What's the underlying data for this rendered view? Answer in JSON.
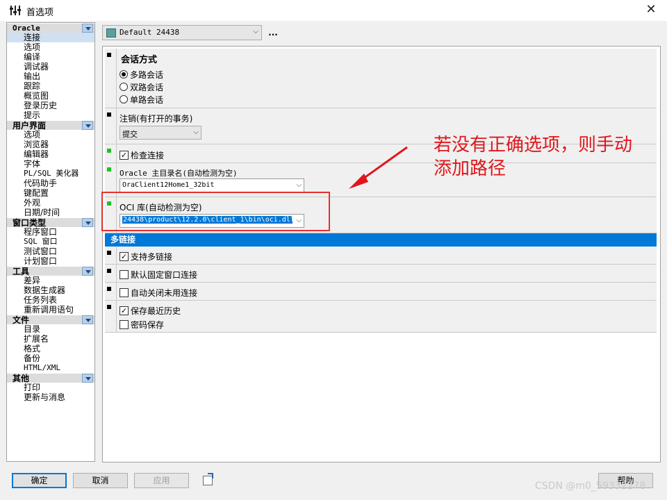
{
  "window": {
    "title": "首选项",
    "close_symbol": "✕"
  },
  "nav": {
    "categories": [
      {
        "label": "Oracle",
        "items": [
          "连接",
          "选项",
          "编译",
          "调试器",
          "输出",
          "跟踪",
          "概览图",
          "登录历史",
          "提示"
        ]
      },
      {
        "label": "用户界面",
        "items": [
          "选项",
          "浏览器",
          "编辑器",
          "字体",
          "PL/SQL 美化器",
          "代码助手",
          "键配置",
          "外观",
          "日期/时间"
        ]
      },
      {
        "label": "窗口类型",
        "items": [
          "程序窗口",
          "SQL 窗口",
          "测试窗口",
          "计划窗口"
        ]
      },
      {
        "label": "工具",
        "items": [
          "差异",
          "数据生成器",
          "任务列表",
          "重新调用语句"
        ]
      },
      {
        "label": "文件",
        "items": [
          "目录",
          "扩展名",
          "格式",
          "备份",
          "HTML/XML"
        ]
      },
      {
        "label": "其他",
        "items": [
          "打印",
          "更新与消息"
        ]
      }
    ],
    "selected": "连接"
  },
  "profile": {
    "value": "Default 24438",
    "more": "..."
  },
  "session": {
    "title": "会话方式",
    "options": [
      "多路会话",
      "双路会话",
      "单路会话"
    ],
    "selected_index": 0
  },
  "logoff": {
    "label": "注销(有打开的事务)",
    "value": "提交"
  },
  "check_connection": {
    "label": "检查连接",
    "checked": true
  },
  "oracle_home": {
    "label": "Oracle 主目录名(自动检测为空)",
    "value": "OraClient12Home1_32bit"
  },
  "oci_library": {
    "label": "OCI 库(自动检测为空)",
    "value": "24438\\product\\12.2.0\\client_1\\bin\\oci.dll"
  },
  "multi": {
    "header": "多链接",
    "support_multi": {
      "label": "支持多链接",
      "checked": true
    },
    "default_fixed": {
      "label": "默认固定窗口连接",
      "checked": false
    },
    "auto_close": {
      "label": "自动关闭未用连接",
      "checked": false
    },
    "save_history": {
      "label": "保存最近历史",
      "checked": true
    },
    "save_password": {
      "label": "密码保存",
      "checked": false
    }
  },
  "annotation": {
    "line1": "若没有正确选项，则手动",
    "line2": "添加路径"
  },
  "buttons": {
    "ok": "确定",
    "cancel": "取消",
    "apply": "应用",
    "help": "帮助"
  },
  "watermark": "CSDN @m0_59332278",
  "colors": {
    "accent": "#0078d7",
    "annotation": "#e0161b",
    "marker_green": "#22c022"
  }
}
